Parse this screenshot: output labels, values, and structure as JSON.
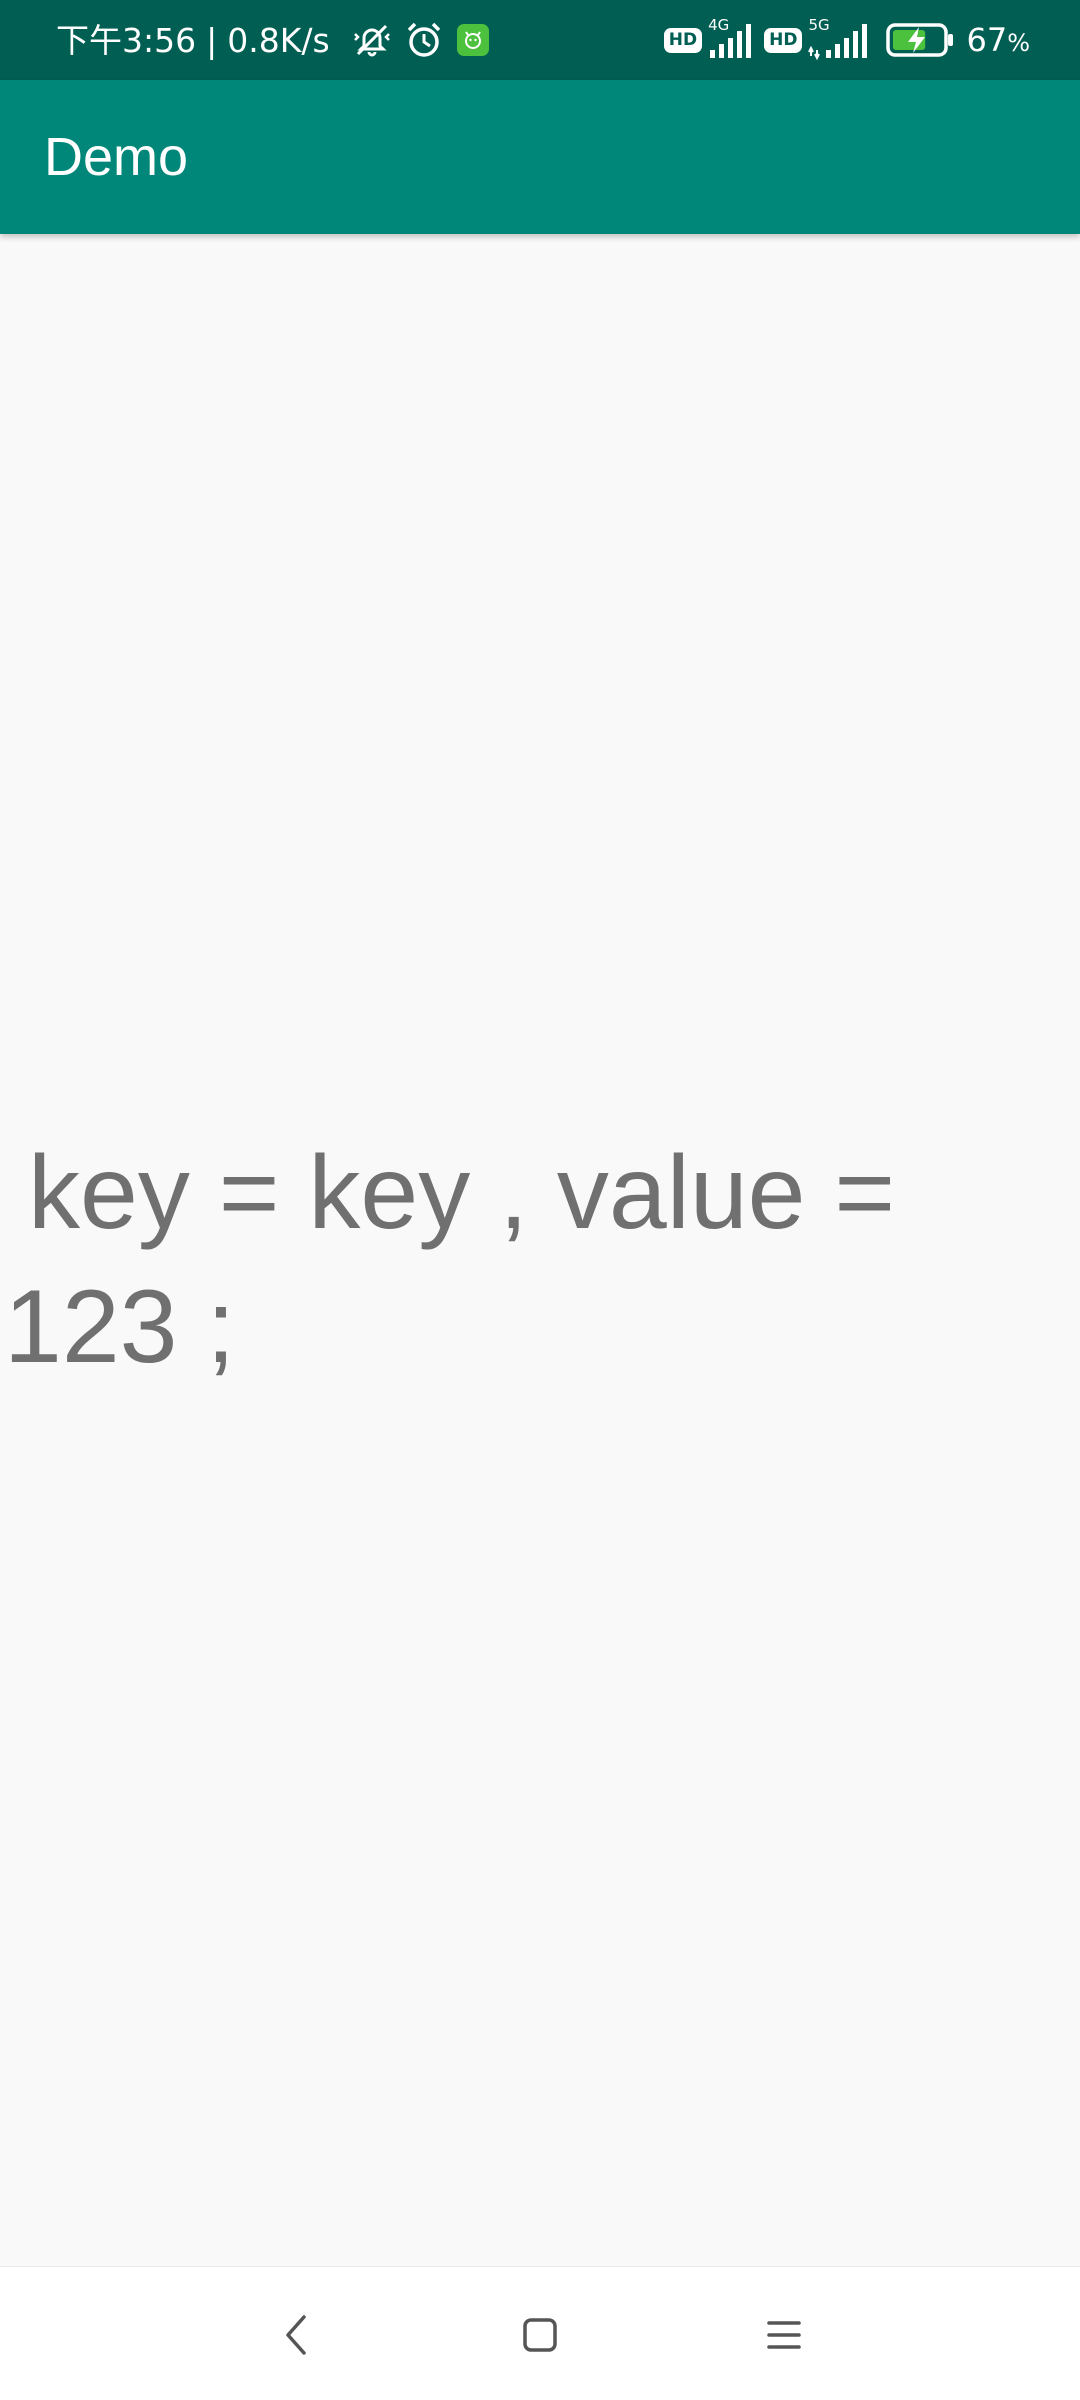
{
  "status_bar": {
    "time": "下午3:56",
    "separator": "|",
    "net_speed": "0.8K/s",
    "icons": [
      "vibrate-mute-icon",
      "alarm-icon",
      "app-notification-icon",
      "hd-volte-icon",
      "signal-4g-icon",
      "hd-volte-icon",
      "signal-5g-icon",
      "battery-charging-icon"
    ],
    "hd_label_1": "HD",
    "net_type_1": "4G",
    "hd_label_2": "HD",
    "net_type_2": "5G",
    "battery_percent": "67",
    "percent_sign": "%",
    "battery_level": 0.67
  },
  "app_bar": {
    "title": "Demo"
  },
  "main": {
    "text": "key = key , value = 123 ;"
  },
  "nav_bar": {
    "icons": [
      "back-icon",
      "home-icon",
      "recents-menu-icon"
    ]
  },
  "colors": {
    "status_bar_bg": "#005E53",
    "app_bar_bg": "#00877A",
    "page_bg": "#FAF9FA",
    "text": "#707070"
  }
}
